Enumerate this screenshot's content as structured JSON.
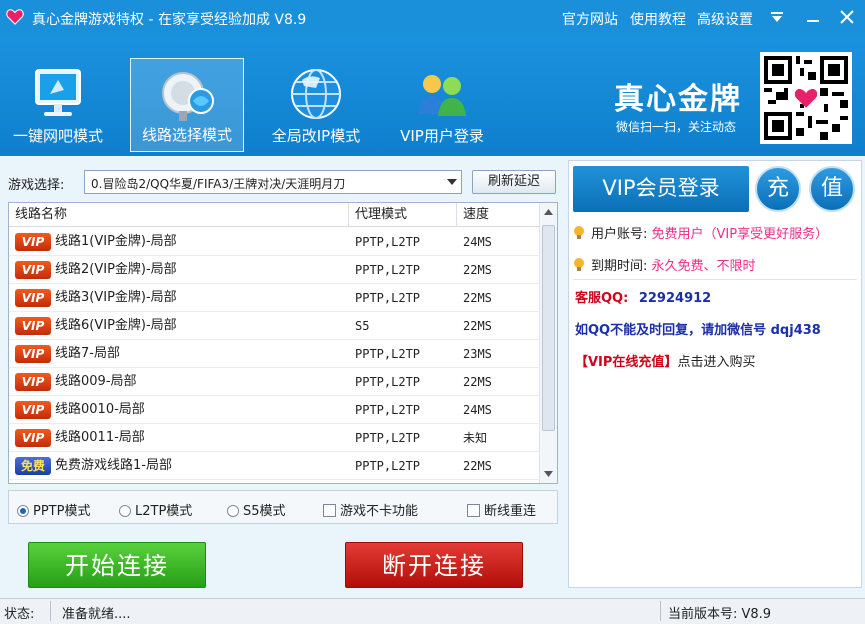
{
  "titlebar": {
    "title": "真心金牌游戏特权 - 在家享受经验加成 V8.9",
    "links": [
      "官方网站",
      "使用教程",
      "高级设置"
    ],
    "app_icon": "heart-icon"
  },
  "header": {
    "modes": [
      {
        "label": "一键网吧模式",
        "icon": "monitor-icon",
        "active": false
      },
      {
        "label": "线路选择模式",
        "icon": "satellite-dish-icon",
        "active": true
      },
      {
        "label": "全局改IP模式",
        "icon": "globe-icon",
        "active": false
      },
      {
        "label": "VIP用户登录",
        "icon": "users-icon",
        "active": false
      }
    ],
    "brand_title": "真心金牌",
    "brand_sub": "微信扫一扫，关注动态"
  },
  "game_select": {
    "label": "游戏选择:",
    "value": "0.冒险岛2/QQ华夏/FIFA3/王牌对决/天涯明月刀",
    "refresh_label": "刷新延迟"
  },
  "table": {
    "headers": [
      "线路名称",
      "代理模式",
      "速度"
    ],
    "rows": [
      {
        "badge": "VIP",
        "name": "线路1(VIP金牌)-局部",
        "mode": "PPTP,L2TP",
        "speed": "24MS"
      },
      {
        "badge": "VIP",
        "name": "线路2(VIP金牌)-局部",
        "mode": "PPTP,L2TP",
        "speed": "22MS"
      },
      {
        "badge": "VIP",
        "name": "线路3(VIP金牌)-局部",
        "mode": "PPTP,L2TP",
        "speed": "22MS"
      },
      {
        "badge": "VIP",
        "name": "线路6(VIP金牌)-局部",
        "mode": "S5",
        "speed": "22MS"
      },
      {
        "badge": "VIP",
        "name": "线路7-局部",
        "mode": "PPTP,L2TP",
        "speed": "23MS"
      },
      {
        "badge": "VIP",
        "name": "线路009-局部",
        "mode": "PPTP,L2TP",
        "speed": "22MS"
      },
      {
        "badge": "VIP",
        "name": "线路0010-局部",
        "mode": "PPTP,L2TP",
        "speed": "24MS"
      },
      {
        "badge": "VIP",
        "name": "线路0011-局部",
        "mode": "PPTP,L2TP",
        "speed": "未知"
      },
      {
        "badge": "免费",
        "name": "免费游戏线路1-局部",
        "mode": "PPTP,L2TP",
        "speed": "22MS"
      }
    ]
  },
  "options": {
    "radios": [
      "PPTP模式",
      "L2TP模式",
      "S5模式"
    ],
    "selected_radio": "PPTP模式",
    "checkboxes": [
      "游戏不卡功能",
      "断线重连"
    ]
  },
  "actions": {
    "start": "开始连接",
    "stop": "断开连接"
  },
  "right_panel": {
    "vip_login": "VIP会员登录",
    "recharge_1": "充",
    "recharge_2": "值",
    "account_label": "用户账号:",
    "account_value": "免费用户（VIP享受更好服务）",
    "expire_label": "到期时间:",
    "expire_value": "永久免费、不限时",
    "kf_label": "客服QQ:",
    "kf_qq": "22924912",
    "wechat_text": "如QQ不能及时回复，请加微信号 dqj438",
    "buy_tag": "【VIP在线充值】",
    "buy_text": "点击进入购买"
  },
  "statusbar": {
    "label": "状态:",
    "status": "准备就绪....",
    "version": "当前版本号: V8.9"
  },
  "colors": {
    "header_blue": "#1a8fda",
    "pink": "#ec2d8a",
    "red": "#d0021b",
    "navy": "#1a2fa8",
    "green_button": "#259f15",
    "red_button": "#b10f0a"
  }
}
